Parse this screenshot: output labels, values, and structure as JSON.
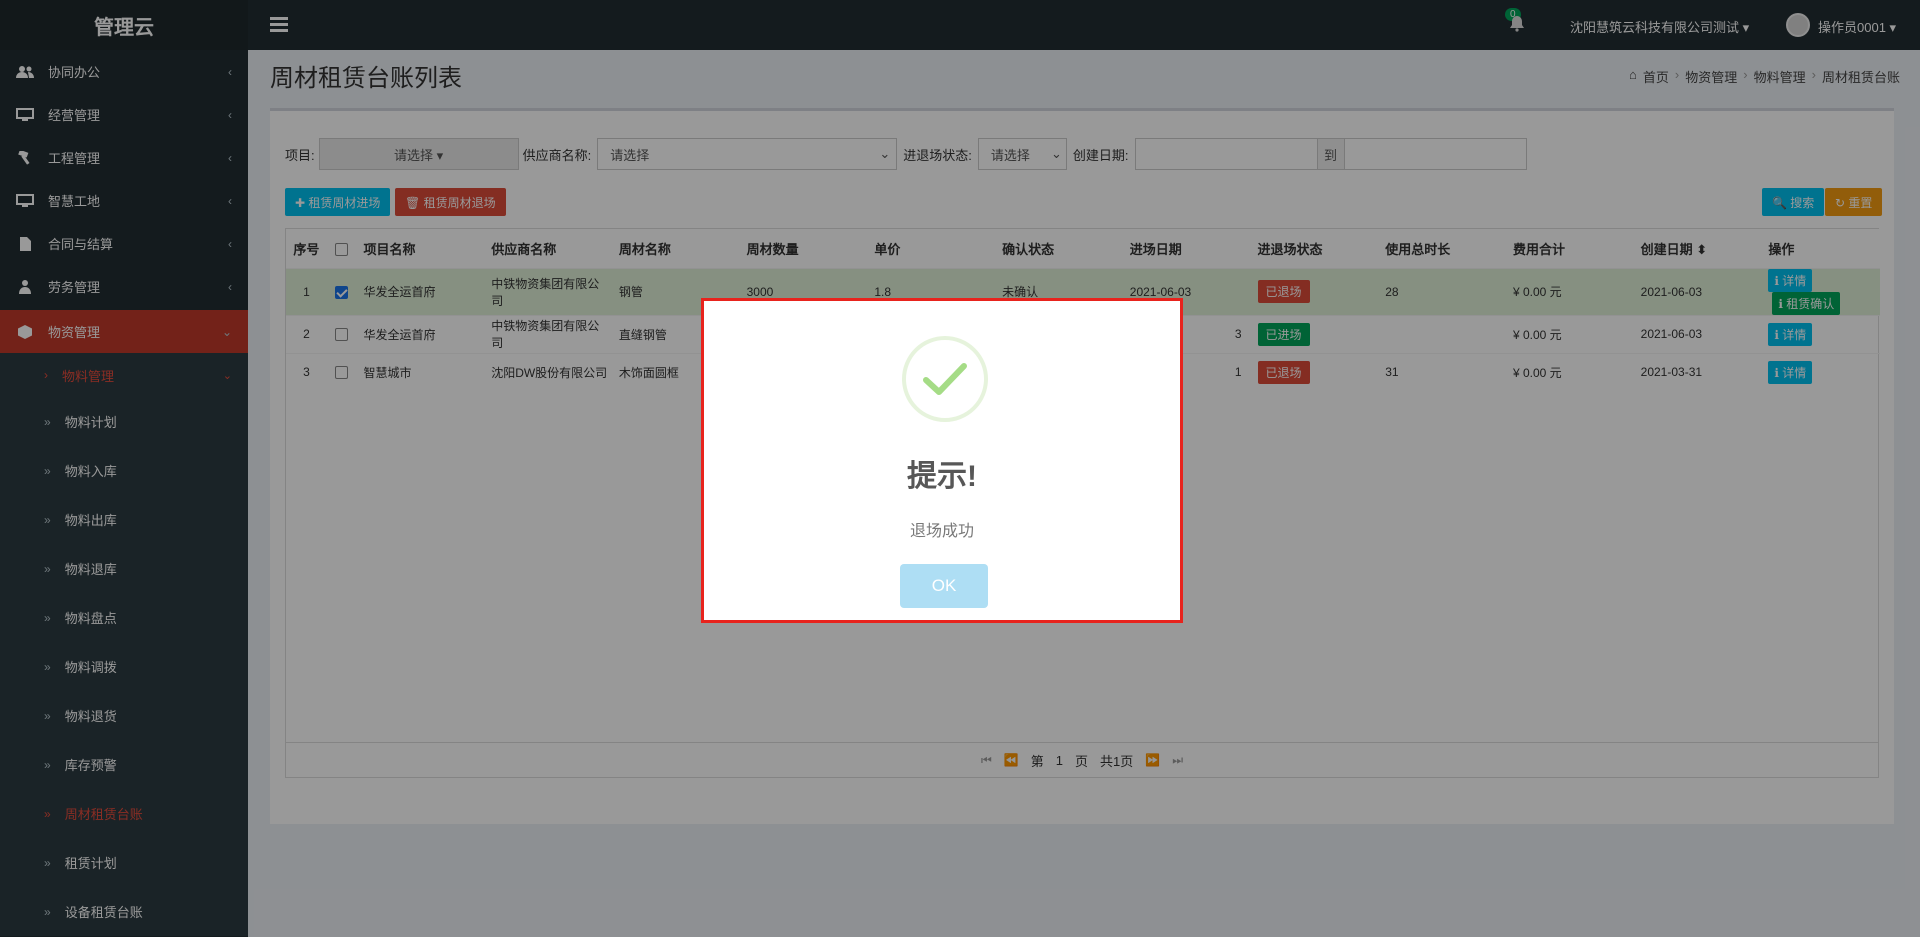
{
  "app": {
    "brand": "管理云",
    "notification_count": "0",
    "company": "沈阳慧筑云科技有限公司测试 ▾",
    "user": "操作员0001 ▾"
  },
  "sidebar": {
    "items": [
      {
        "label": "协同办公"
      },
      {
        "label": "经营管理"
      },
      {
        "label": "工程管理"
      },
      {
        "label": "智慧工地"
      },
      {
        "label": "合同与结算"
      },
      {
        "label": "劳务管理"
      }
    ],
    "active": {
      "label": "物资管理"
    },
    "submenu_open": {
      "label": "物料管理"
    },
    "subitems": [
      {
        "label": "物料计划"
      },
      {
        "label": "物料入库"
      },
      {
        "label": "物料出库"
      },
      {
        "label": "物料退库"
      },
      {
        "label": "物料盘点"
      },
      {
        "label": "物料调拨"
      },
      {
        "label": "物料退货"
      },
      {
        "label": "库存预警"
      },
      {
        "label": "周材租赁台账"
      },
      {
        "label": "租赁计划"
      },
      {
        "label": "设备租赁台账"
      }
    ]
  },
  "header": {
    "title": "周材租赁台账列表",
    "breadcrumb": [
      "首页",
      "物资管理",
      "物料管理",
      "周材租赁台账"
    ]
  },
  "filters": {
    "project_label": "项目:",
    "project_value": "请选择 ▾",
    "supplier_label": "供应商名称:",
    "supplier_value": "请选择",
    "status_label": "进退场状态:",
    "status_value": "请选择",
    "date_label": "创建日期:",
    "date_to": "到"
  },
  "toolbar": {
    "enter_button": "✚ 租赁周材进场",
    "exit_button": "🗑 租赁周材退场",
    "search_button": "🔍 搜索",
    "reset_button": "↻ 重置"
  },
  "table": {
    "columns": [
      "序号",
      "",
      "项目名称",
      "供应商名称",
      "周材名称",
      "周材数量",
      "单价",
      "确认状态",
      "进场日期",
      "进退场状态",
      "使用总时长",
      "费用合计",
      "创建日期 ⬍",
      "操作"
    ],
    "rows": [
      {
        "idx": "1",
        "checked": true,
        "project": "华发全运首府",
        "supplier": "中铁物资集团有限公司",
        "material": "钢管",
        "qty": "3000",
        "price": "1.8",
        "confirm": "未确认",
        "enter_date": "2021-06-03",
        "status": "已退场",
        "duration": "28",
        "total": "¥ 0.00 元",
        "created": "2021-06-03",
        "op1": "ℹ 详情",
        "op2": "ℹ 租赁确认"
      },
      {
        "idx": "2",
        "checked": false,
        "project": "华发全运首府",
        "supplier": "中铁物资集团有限公司",
        "material": "直缝钢管",
        "qty": "",
        "price": "",
        "confirm": "",
        "enter_date": "3",
        "status": "已进场",
        "duration": "",
        "total": "¥ 0.00 元",
        "created": "2021-06-03",
        "op1": "ℹ 详情",
        "op2": ""
      },
      {
        "idx": "3",
        "checked": false,
        "project": "智慧城市",
        "supplier": "沈阳DW股份有限公司",
        "material": "木饰面圆框",
        "qty": "",
        "price": "",
        "confirm": "",
        "enter_date": "1",
        "status": "已退场",
        "duration": "31",
        "total": "¥ 0.00 元",
        "created": "2021-03-31",
        "op1": "ℹ 详情",
        "op2": ""
      }
    ]
  },
  "pager": {
    "prefix": "第",
    "page": "1",
    "suffix": "页",
    "total": "共1页"
  },
  "modal": {
    "title": "提示!",
    "text": "退场成功",
    "ok": "OK"
  }
}
